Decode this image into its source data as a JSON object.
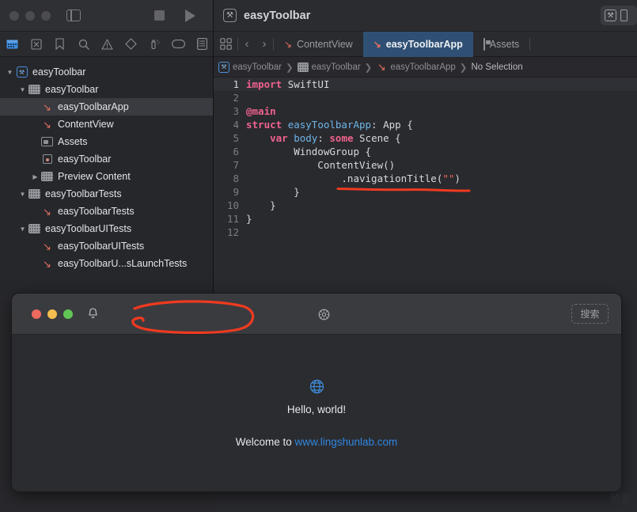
{
  "window": {
    "project_name": "easyToolbar",
    "traffic_lights": [
      "close",
      "minimize",
      "zoom"
    ],
    "toolbar_icons": [
      "sidebar-toggle-icon",
      "stop-icon",
      "run-icon"
    ],
    "project_icon": "xcode-project-icon"
  },
  "navigator_strip": {
    "icons": [
      {
        "name": "folder-navigator-icon",
        "glyph": "▦",
        "active": true
      },
      {
        "name": "source-control-navigator-icon",
        "glyph": "⊠",
        "active": false
      },
      {
        "name": "bookmark-navigator-icon",
        "glyph": "🔖",
        "active": false
      },
      {
        "name": "search-navigator-icon",
        "glyph": "⌕",
        "active": false
      },
      {
        "name": "issue-navigator-icon",
        "glyph": "⚠",
        "active": false
      },
      {
        "name": "test-navigator-icon",
        "glyph": "◈",
        "active": false
      },
      {
        "name": "debug-navigator-icon",
        "glyph": "⚗",
        "active": false
      },
      {
        "name": "breakpoint-navigator-icon",
        "glyph": "▭",
        "active": false
      },
      {
        "name": "report-navigator-icon",
        "glyph": "▤",
        "active": false
      }
    ]
  },
  "navigator": {
    "items": [
      {
        "label": "easyToolbar",
        "indent": 0,
        "twisty": "open",
        "icon": "xcode-project-icon",
        "selected": false
      },
      {
        "label": "easyToolbar",
        "indent": 1,
        "twisty": "open",
        "icon": "folder-icon",
        "selected": false
      },
      {
        "label": "easyToolbarApp",
        "indent": 2,
        "twisty": "none",
        "icon": "swift-file-icon",
        "selected": true
      },
      {
        "label": "ContentView",
        "indent": 2,
        "twisty": "none",
        "icon": "swift-file-icon",
        "selected": false
      },
      {
        "label": "Assets",
        "indent": 2,
        "twisty": "none",
        "icon": "assets-icon",
        "selected": false
      },
      {
        "label": "easyToolbar",
        "indent": 2,
        "twisty": "none",
        "icon": "entitlements-icon",
        "selected": false
      },
      {
        "label": "Preview Content",
        "indent": 2,
        "twisty": "closed",
        "icon": "folder-icon",
        "selected": false
      },
      {
        "label": "easyToolbarTests",
        "indent": 1,
        "twisty": "open",
        "icon": "folder-icon",
        "selected": false
      },
      {
        "label": "easyToolbarTests",
        "indent": 2,
        "twisty": "none",
        "icon": "swift-file-icon",
        "selected": false
      },
      {
        "label": "easyToolbarUITests",
        "indent": 1,
        "twisty": "open",
        "icon": "folder-icon",
        "selected": false
      },
      {
        "label": "easyToolbarUITests",
        "indent": 2,
        "twisty": "none",
        "icon": "swift-file-icon",
        "selected": false
      },
      {
        "label": "easyToolbarU...sLaunchTests",
        "indent": 2,
        "twisty": "none",
        "icon": "swift-file-icon",
        "selected": false
      }
    ]
  },
  "editor": {
    "tabs": [
      {
        "label": "ContentView",
        "icon": "swift-file-icon",
        "active": false
      },
      {
        "label": "easyToolbarApp",
        "icon": "swift-file-icon",
        "active": true
      },
      {
        "label": "Assets",
        "icon": "assets-icon",
        "active": false
      }
    ],
    "nav_back": "‹",
    "nav_forward": "›",
    "breadcrumbs": [
      {
        "label": "easyToolbar",
        "icon": "xcode-project-icon"
      },
      {
        "label": "easyToolbar",
        "icon": "folder-icon"
      },
      {
        "label": "easyToolbarApp",
        "icon": "swift-file-icon"
      },
      {
        "label": "No Selection",
        "icon": "none"
      }
    ],
    "breadcrumb_separator": "❯",
    "code_lines": [
      {
        "n": "1",
        "current": true,
        "tokens": [
          {
            "t": "import ",
            "c": "kw"
          },
          {
            "t": "SwiftUI",
            "c": "code"
          }
        ]
      },
      {
        "n": "2",
        "current": false,
        "tokens": []
      },
      {
        "n": "3",
        "current": false,
        "tokens": [
          {
            "t": "@main",
            "c": "at"
          }
        ]
      },
      {
        "n": "4",
        "current": false,
        "tokens": [
          {
            "t": "struct ",
            "c": "kw"
          },
          {
            "t": "easyToolbarApp",
            "c": "ty"
          },
          {
            "t": ": App {",
            "c": "code"
          }
        ]
      },
      {
        "n": "5",
        "current": false,
        "tokens": [
          {
            "t": "    var ",
            "c": "kw"
          },
          {
            "t": "body",
            "c": "ty"
          },
          {
            "t": ": ",
            "c": "code"
          },
          {
            "t": "some ",
            "c": "kw"
          },
          {
            "t": "Scene {",
            "c": "code"
          }
        ]
      },
      {
        "n": "6",
        "current": false,
        "tokens": [
          {
            "t": "        WindowGroup {",
            "c": "code"
          }
        ]
      },
      {
        "n": "7",
        "current": false,
        "tokens": [
          {
            "t": "            ContentView()",
            "c": "code"
          }
        ]
      },
      {
        "n": "8",
        "current": false,
        "tokens": [
          {
            "t": "                .navigationTitle(",
            "c": "code"
          },
          {
            "t": "\"\"",
            "c": "str"
          },
          {
            "t": ")",
            "c": "code"
          }
        ]
      },
      {
        "n": "9",
        "current": false,
        "tokens": [
          {
            "t": "        }",
            "c": "code"
          }
        ]
      },
      {
        "n": "10",
        "current": false,
        "tokens": [
          {
            "t": "    }",
            "c": "code"
          }
        ]
      },
      {
        "n": "11",
        "current": false,
        "tokens": [
          {
            "t": "}",
            "c": "code"
          }
        ]
      },
      {
        "n": "12",
        "current": false,
        "tokens": []
      }
    ]
  },
  "preview_window": {
    "traffic_lights": [
      "close",
      "minimize",
      "zoom"
    ],
    "notification_icon": "bell-icon",
    "settings_icon": "gear-icon",
    "search_placeholder": "搜索",
    "content": {
      "globe_icon": "globe-icon",
      "heading": "Hello, world!",
      "welcome_prefix": "Welcome to ",
      "link_text": "www.lingshunlab.com"
    }
  },
  "annotations": {
    "ellipse_color": "#f03a20",
    "underline_color": "#f03a20",
    "ellipse_target": "empty-toolbar-title-area",
    "underline_target": "navigationTitle-call"
  },
  "watermark": "验室",
  "colors": {
    "accent_blue": "#2f86e0",
    "tab_active_bg": "#2f5074",
    "keyword_pink": "#f0628e",
    "type_blue": "#6fb5e8",
    "string_red": "#f0675a",
    "annotation_red": "#f03a20"
  }
}
